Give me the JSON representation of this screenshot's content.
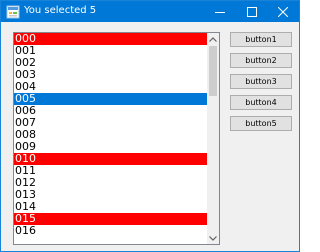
{
  "window": {
    "title": "You selected 5"
  },
  "colors": {
    "titlebar": "#0078d7",
    "highlight_red": "#ff0000",
    "selection_blue": "#0078d7"
  },
  "listbox": {
    "items": [
      {
        "text": "000",
        "style": "red"
      },
      {
        "text": "001",
        "style": "normal"
      },
      {
        "text": "002",
        "style": "normal"
      },
      {
        "text": "003",
        "style": "normal"
      },
      {
        "text": "004",
        "style": "normal"
      },
      {
        "text": "005",
        "style": "selected"
      },
      {
        "text": "006",
        "style": "normal"
      },
      {
        "text": "007",
        "style": "normal"
      },
      {
        "text": "008",
        "style": "normal"
      },
      {
        "text": "009",
        "style": "normal"
      },
      {
        "text": "010",
        "style": "red"
      },
      {
        "text": "011",
        "style": "normal"
      },
      {
        "text": "012",
        "style": "normal"
      },
      {
        "text": "013",
        "style": "normal"
      },
      {
        "text": "014",
        "style": "normal"
      },
      {
        "text": "015",
        "style": "red"
      },
      {
        "text": "016",
        "style": "normal"
      }
    ]
  },
  "buttons": {
    "b1": "button1",
    "b2": "button2",
    "b3": "button3",
    "b4": "button4",
    "b5": "button5"
  },
  "icons": {
    "app": "app-icon",
    "minimize": "minimize-icon",
    "maximize": "maximize-icon",
    "close": "close-icon",
    "scroll_up": "chevron-up-icon",
    "scroll_down": "chevron-down-icon"
  }
}
